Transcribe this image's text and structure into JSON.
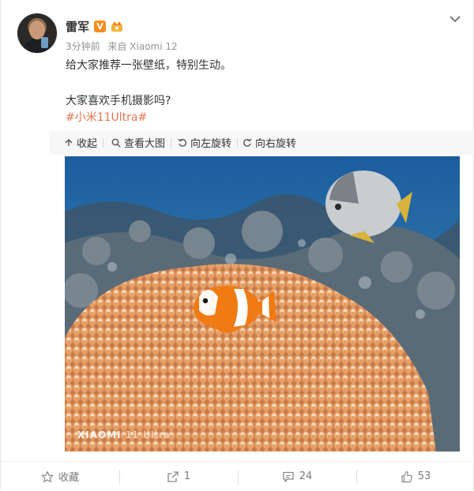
{
  "post": {
    "author": "雷军",
    "verified_badge": "V",
    "meta_time": "3分钟前",
    "meta_source": "来自 Xiaomi 12",
    "lines": [
      "给大家推荐一张壁纸，特别生动。",
      "大家喜欢手机摄影吗?"
    ],
    "hashtag": "#小米11Ultra#"
  },
  "toolbar": {
    "collapse": "收起",
    "view_large": "查看大图",
    "rotate_left": "向左旋转",
    "rotate_right": "向右旋转"
  },
  "photo": {
    "watermark_brand": "XIAOMI",
    "watermark_model": "11",
    "watermark_suffix": "Ultra"
  },
  "footer": {
    "favorite": "收藏",
    "share_count": "1",
    "comment_count": "24",
    "like_count": "53"
  },
  "colors": {
    "hashtag": "#eb7350",
    "badge": "#f78c1e",
    "toolbar_bg": "#f7f7f7"
  }
}
